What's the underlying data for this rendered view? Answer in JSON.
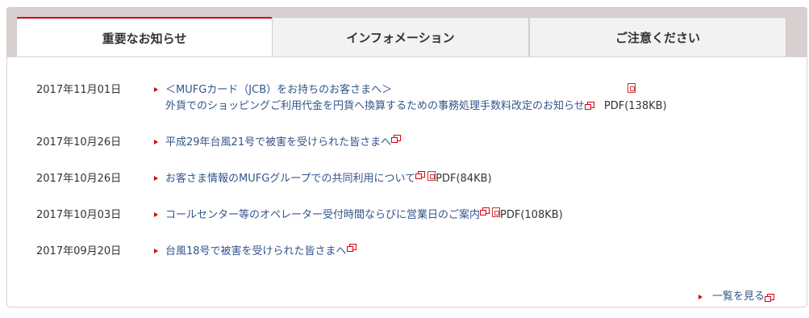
{
  "tabs": [
    {
      "label": "重要なお知らせ"
    },
    {
      "label": "インフォメーション"
    },
    {
      "label": "ご注意ください"
    }
  ],
  "news": [
    {
      "date": "2017年11月01日",
      "line1": "＜MUFGカード（JCB）をお持ちのお客さまへ＞",
      "line2": "外貨でのショッピングご利用代金を円貨へ換算するための事務処理手数料改定のお知らせ",
      "pdf_size": "PDF(138KB)"
    },
    {
      "date": "2017年10月26日",
      "title": "平成29年台風21号で被害を受けられた皆さまへ"
    },
    {
      "date": "2017年10月26日",
      "title": "お客さま情報のMUFGグループでの共同利用について",
      "pdf_size": "PDF(84KB)"
    },
    {
      "date": "2017年10月03日",
      "title": "コールセンター等のオペレーター受付時間ならびに営業日のご案内",
      "pdf_size": "PDF(108KB)"
    },
    {
      "date": "2017年09月20日",
      "title": "台風18号で被害を受けられた皆さまへ"
    }
  ],
  "more_link": "一覧を見る",
  "colors": {
    "accent": "#d7000f",
    "link": "#33558b",
    "frame": "#d7d0ce"
  }
}
